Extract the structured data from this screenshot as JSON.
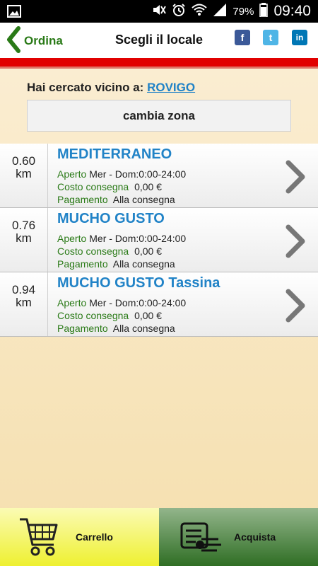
{
  "status_bar": {
    "battery_percent": "79%",
    "time": "09:40"
  },
  "header": {
    "back_label": "Ordina",
    "title": "Scegli il locale"
  },
  "social": {
    "facebook": "f",
    "twitter": "t",
    "linkedin": "in"
  },
  "search": {
    "label": "Hai cercato vicino a:",
    "city": "ROVIGO",
    "change_zone": "cambia zona"
  },
  "restaurants": [
    {
      "distance": "0.60",
      "unit": "km",
      "name": "MEDITERRANEO",
      "open_label": "Aperto",
      "open_value": "Mer - Dom:0:00-24:00",
      "delivery_label": "Costo consegna",
      "delivery_value": "0,00 €",
      "payment_label": "Pagamento",
      "payment_value": "Alla consegna"
    },
    {
      "distance": "0.76",
      "unit": "km",
      "name": "MUCHO GUSTO",
      "open_label": "Aperto",
      "open_value": "Mer - Dom:0:00-24:00",
      "delivery_label": "Costo consegna",
      "delivery_value": "0,00 €",
      "payment_label": "Pagamento",
      "payment_value": "Alla consegna"
    },
    {
      "distance": "0.94",
      "unit": "km",
      "name": "MUCHO GUSTO Tassina",
      "open_label": "Aperto",
      "open_value": "Mer - Dom:0:00-24:00",
      "delivery_label": "Costo consegna",
      "delivery_value": "0,00 €",
      "payment_label": "Pagamento",
      "payment_value": "Alla consegna"
    }
  ],
  "bottom": {
    "cart_label": "Carrello",
    "buy_label": "Acquista"
  },
  "colors": {
    "accent_green": "#2a7a17",
    "link_blue": "#2183c7",
    "header_red": "#e10000"
  },
  "icons": [
    "image-icon",
    "mute-icon",
    "alarm-icon",
    "wifi-icon",
    "signal-icon",
    "battery-icon",
    "back-chevron-icon",
    "facebook-icon",
    "twitter-icon",
    "linkedin-icon",
    "chevron-right-icon",
    "cart-icon",
    "checkout-icon"
  ]
}
